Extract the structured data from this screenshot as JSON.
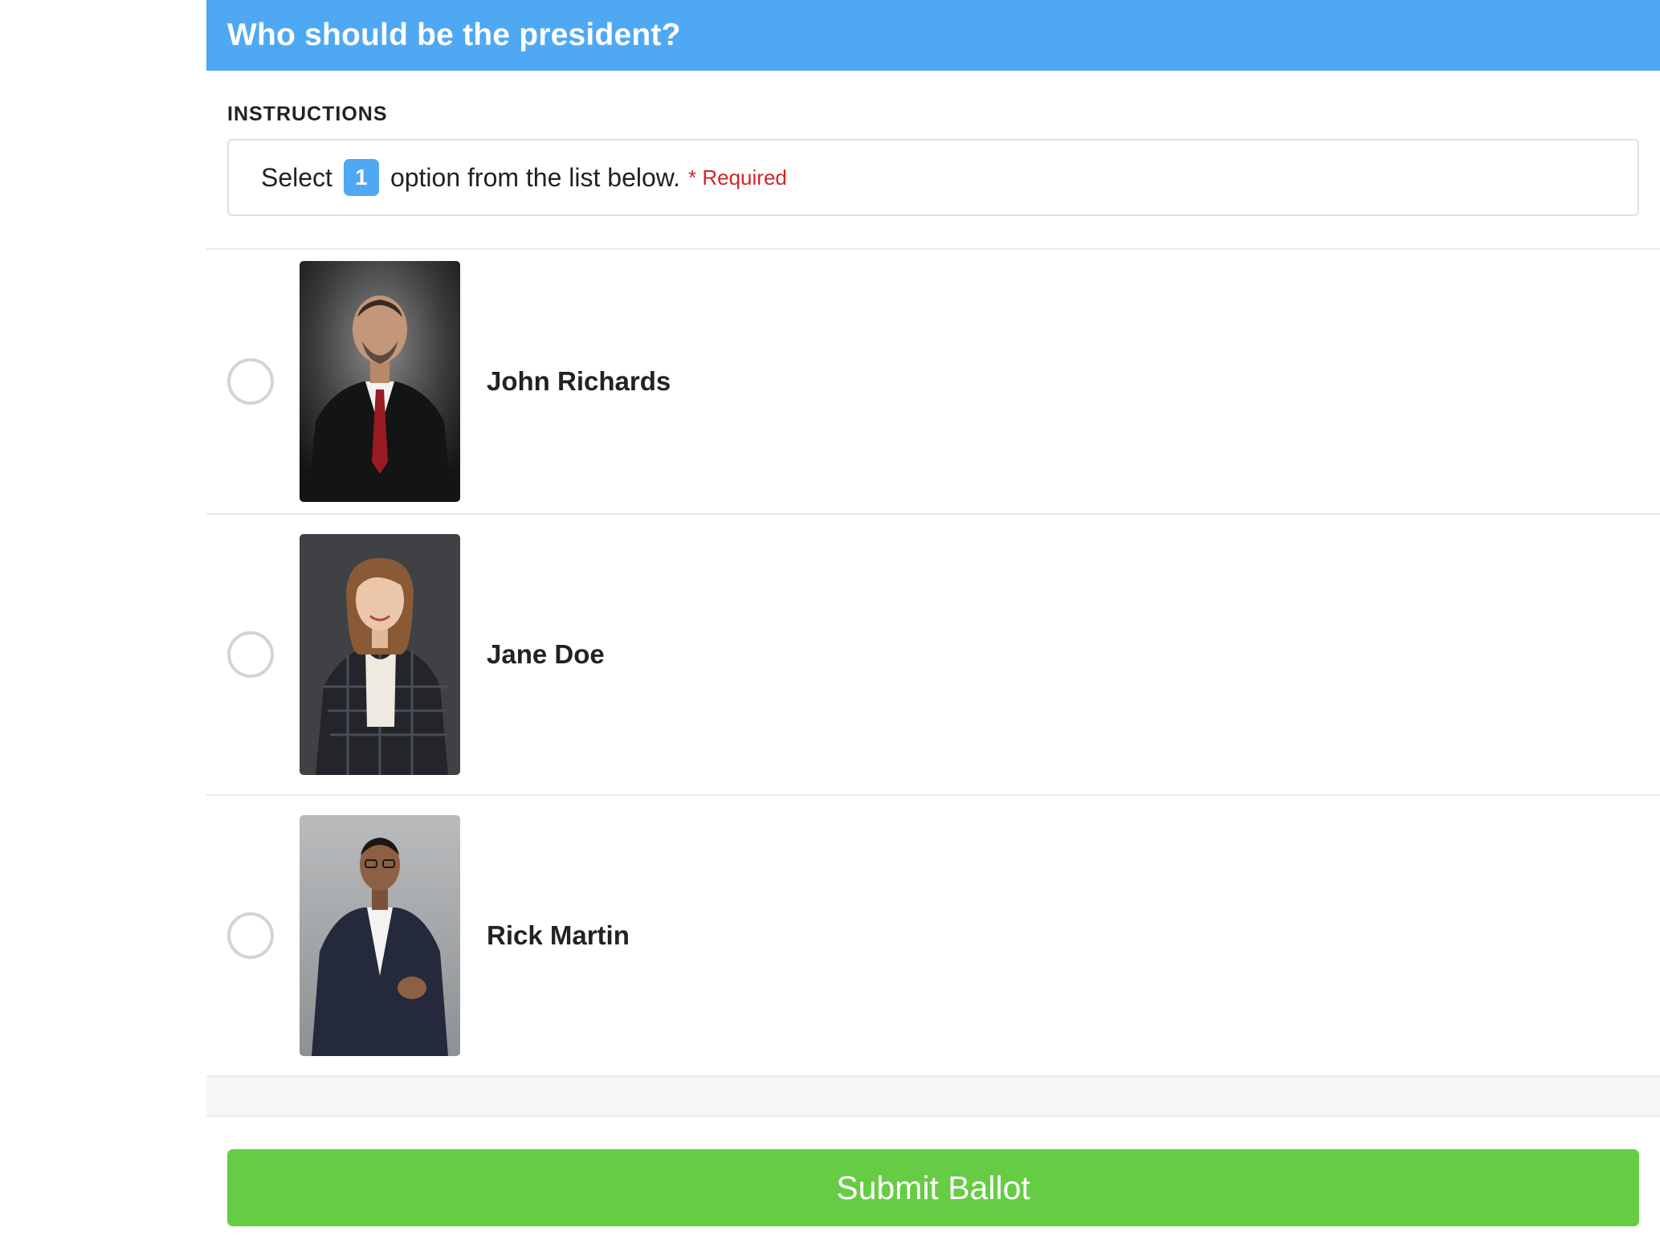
{
  "question": {
    "title": "Who should be the president?"
  },
  "instructions": {
    "heading": "INSTRUCTIONS",
    "prefix": "Select",
    "count": "1",
    "suffix": "option from the list below.",
    "required": "* Required"
  },
  "options": [
    {
      "name": "John Richards",
      "photo": "candidate-photo-man-red-tie"
    },
    {
      "name": "Jane Doe",
      "photo": "candidate-photo-woman-plaid-blazer"
    },
    {
      "name": "Rick Martin",
      "photo": "candidate-photo-man-navy-suit"
    }
  ],
  "submit": {
    "label": "Submit Ballot"
  },
  "colors": {
    "header": "#4ea9f2",
    "submit": "#66cc44",
    "required": "#d0262a"
  }
}
